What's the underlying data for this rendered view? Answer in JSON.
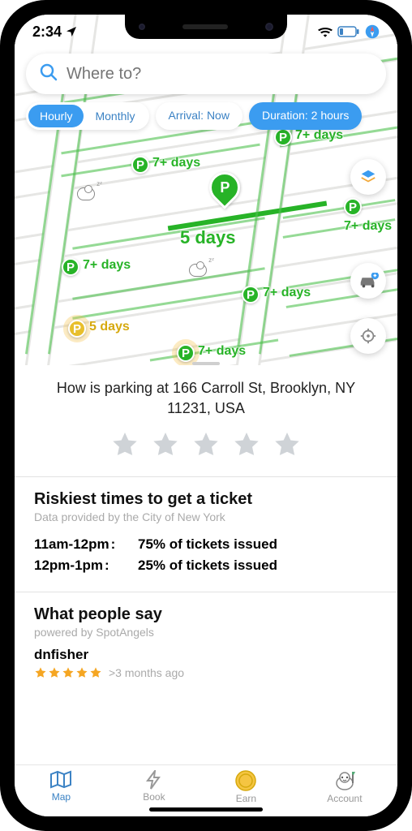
{
  "status": {
    "time": "2:34"
  },
  "search": {
    "placeholder": "Where to?"
  },
  "segments": {
    "hourly": "Hourly",
    "monthly": "Monthly"
  },
  "pills": {
    "arrival": "Arrival: Now",
    "duration": "Duration: 2 hours"
  },
  "map_markers": {
    "selected_label": "5 days",
    "labels": [
      "7+ days",
      "7+ days",
      "7+ days",
      "7+ days",
      "7+ days",
      "7+ days",
      "5 days"
    ]
  },
  "panel": {
    "question": "How is parking at 166 Carroll St, Brooklyn, NY 11231, USA"
  },
  "risk": {
    "title": "Riskiest times to get a ticket",
    "subtitle": "Data provided by the City of New York",
    "rows": [
      {
        "time": "11am-12pm",
        "pct": "75% of tickets issued"
      },
      {
        "time": "12pm-1pm",
        "pct": "25% of tickets issued"
      }
    ]
  },
  "reviews": {
    "title": "What people say",
    "subtitle": "powered by SpotAngels",
    "first": {
      "name": "dnfisher",
      "age": ">3 months ago",
      "stars": 5
    }
  },
  "tabs": {
    "map": "Map",
    "book": "Book",
    "earn": "Earn",
    "account": "Account"
  }
}
